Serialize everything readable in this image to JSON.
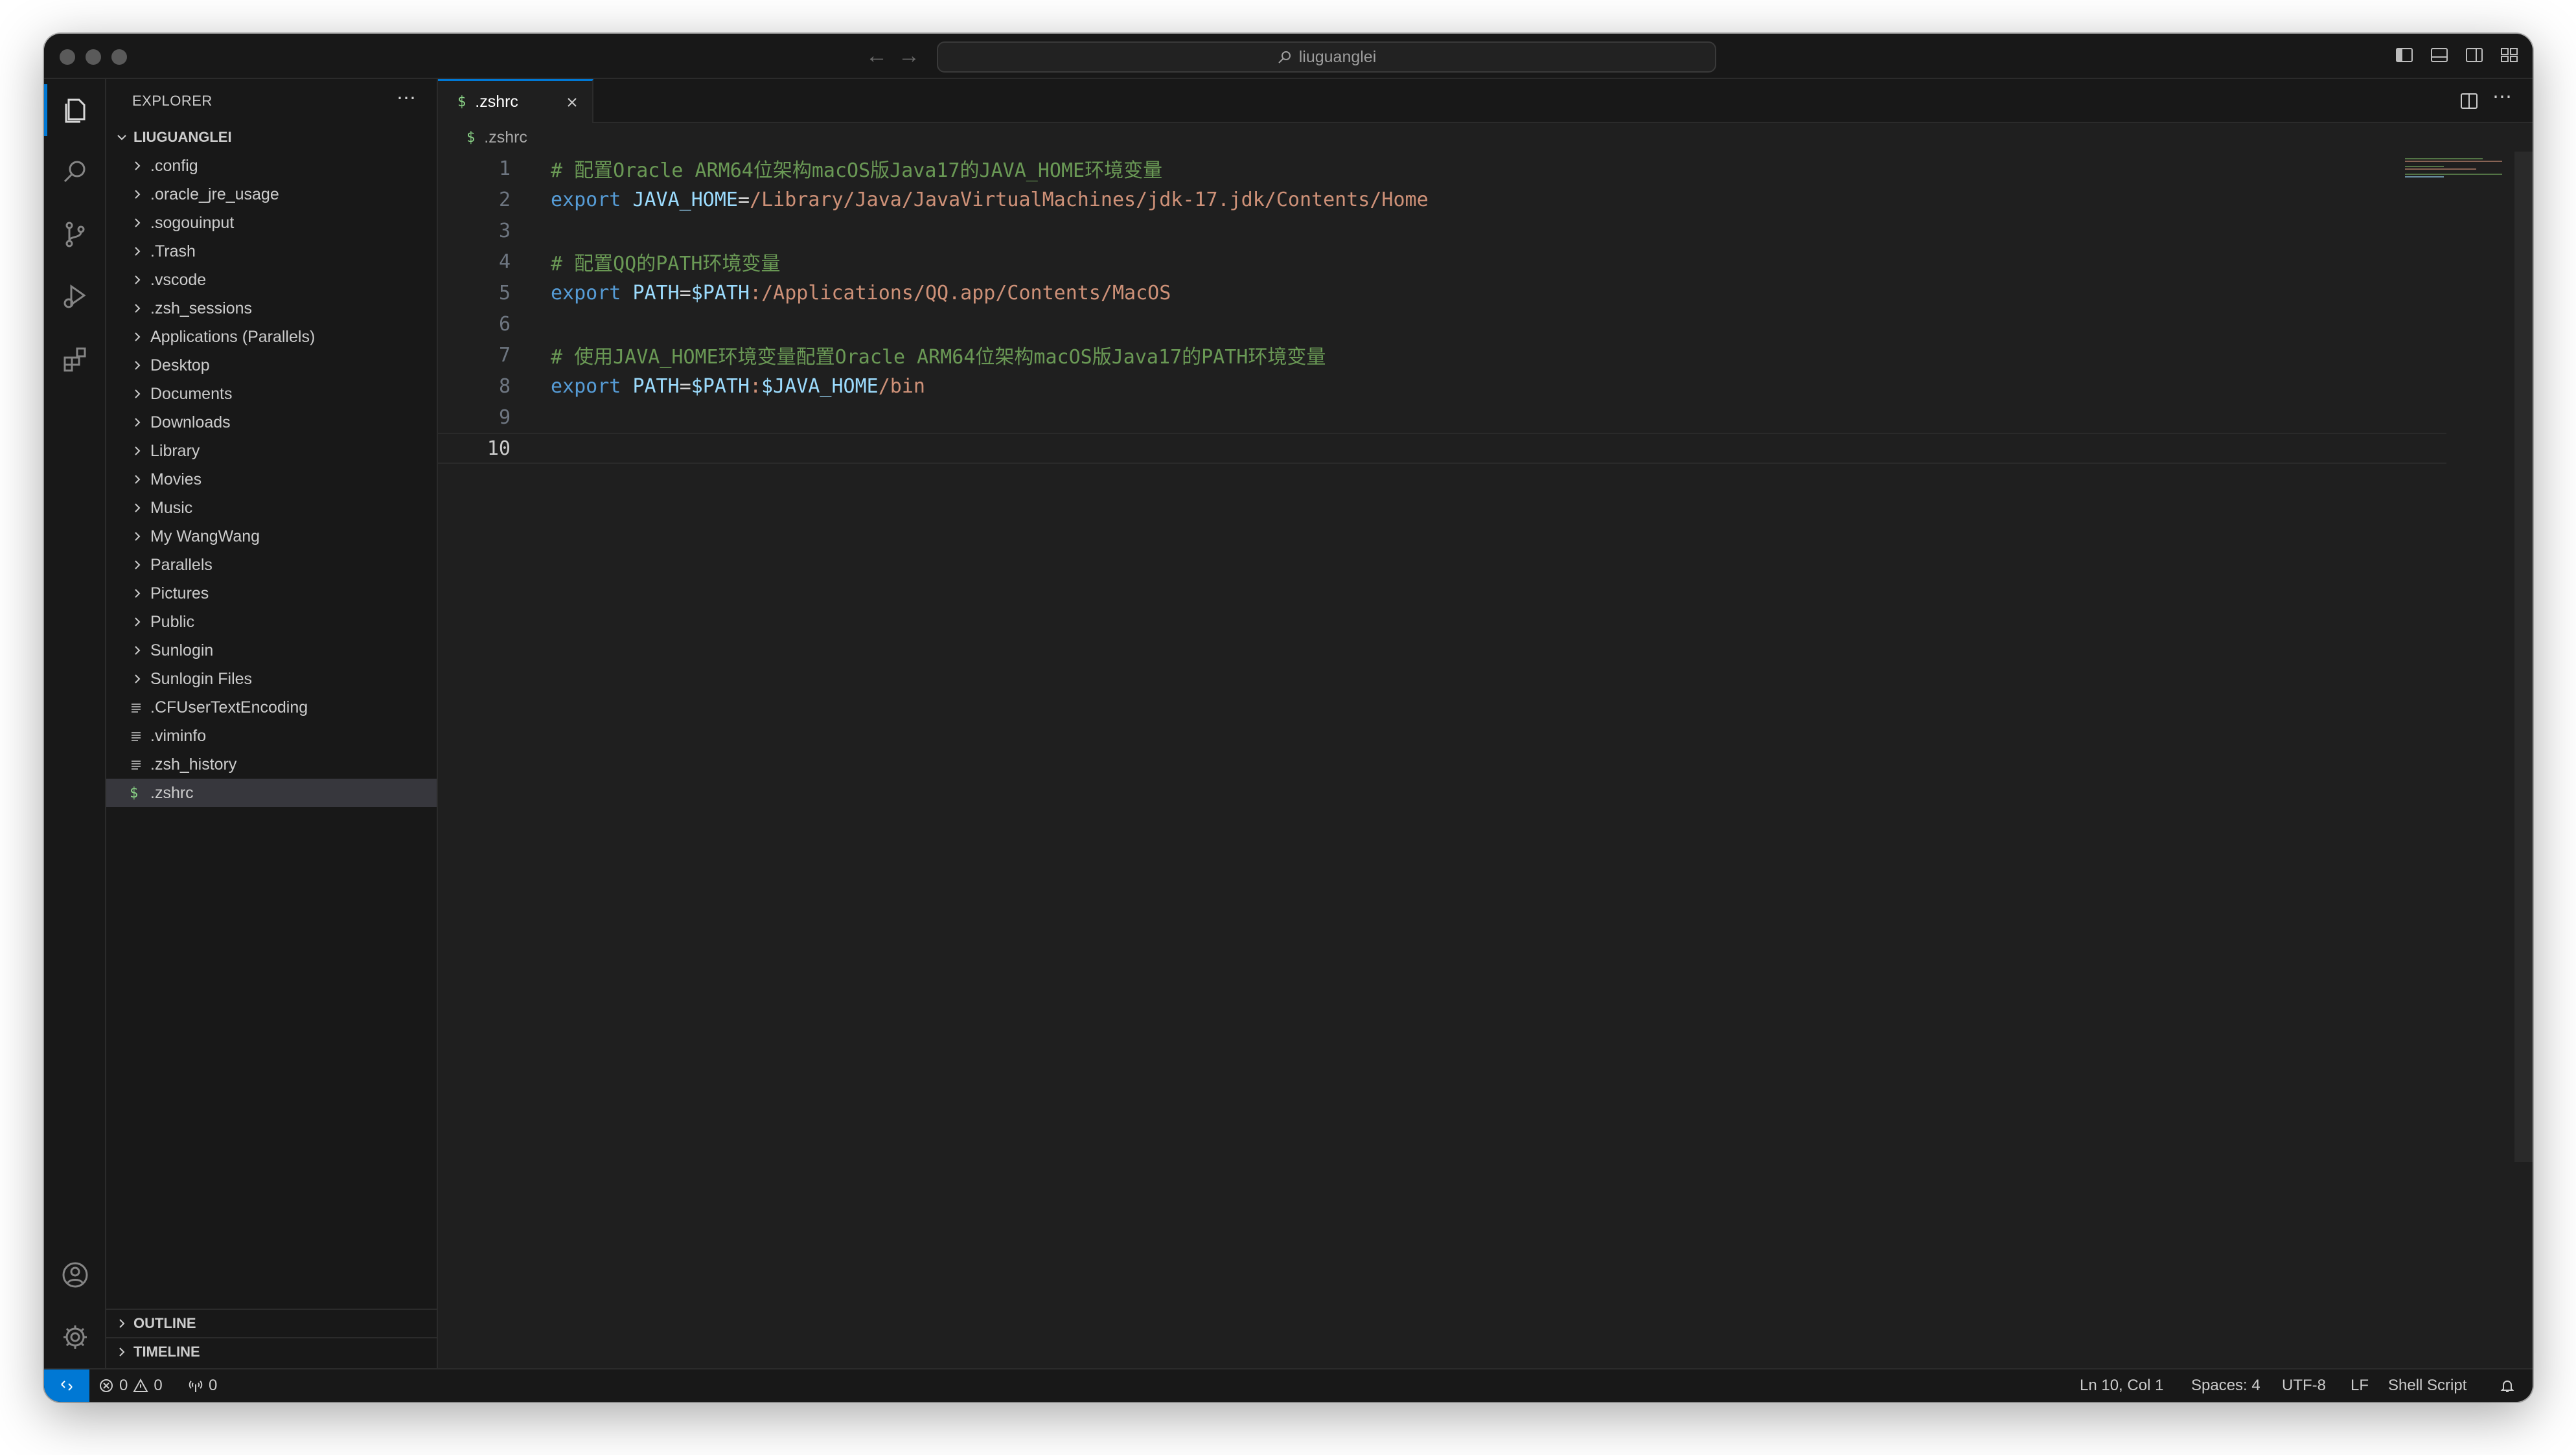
{
  "titlebar": {
    "command_center": "liuguanglei"
  },
  "sidebar": {
    "title": "EXPLORER",
    "folder": "LIUGUANGLEI",
    "items": [
      {
        "label": ".config",
        "kind": "folder"
      },
      {
        "label": ".oracle_jre_usage",
        "kind": "folder"
      },
      {
        "label": ".sogouinput",
        "kind": "folder"
      },
      {
        "label": ".Trash",
        "kind": "folder"
      },
      {
        "label": ".vscode",
        "kind": "folder"
      },
      {
        "label": ".zsh_sessions",
        "kind": "folder"
      },
      {
        "label": "Applications (Parallels)",
        "kind": "folder"
      },
      {
        "label": "Desktop",
        "kind": "folder"
      },
      {
        "label": "Documents",
        "kind": "folder"
      },
      {
        "label": "Downloads",
        "kind": "folder"
      },
      {
        "label": "Library",
        "kind": "folder"
      },
      {
        "label": "Movies",
        "kind": "folder"
      },
      {
        "label": "Music",
        "kind": "folder"
      },
      {
        "label": "My WangWang",
        "kind": "folder"
      },
      {
        "label": "Parallels",
        "kind": "folder"
      },
      {
        "label": "Pictures",
        "kind": "folder"
      },
      {
        "label": "Public",
        "kind": "folder"
      },
      {
        "label": "Sunlogin",
        "kind": "folder"
      },
      {
        "label": "Sunlogin Files",
        "kind": "folder"
      },
      {
        "label": ".CFUserTextEncoding",
        "kind": "file"
      },
      {
        "label": ".viminfo",
        "kind": "file"
      },
      {
        "label": ".zsh_history",
        "kind": "file"
      },
      {
        "label": ".zshrc",
        "kind": "shell",
        "selected": true
      }
    ],
    "outline": "OUTLINE",
    "timeline": "TIMELINE"
  },
  "editor": {
    "tab": ".zshrc",
    "breadcrumb": ".zshrc",
    "file_icon": "$",
    "lines": [
      {
        "num": "1",
        "comment": "# 配置Oracle ARM64位架构macOS版Java17的JAVA_HOME环境变量"
      },
      {
        "num": "2",
        "kw": "export",
        "var": "JAVA_HOME",
        "op": "=",
        "rest": "/Library/Java/JavaVirtualMachines/jdk-17.jdk/Contents/Home"
      },
      {
        "num": "3"
      },
      {
        "num": "4",
        "comment": "# 配置QQ的PATH环境变量"
      },
      {
        "num": "5",
        "kw": "export",
        "var": "PATH",
        "op": "=",
        "var2": "$PATH",
        "rest": ":/Applications/QQ.app/Contents/MacOS"
      },
      {
        "num": "6"
      },
      {
        "num": "7",
        "comment": "# 使用JAVA_HOME环境变量配置Oracle ARM64位架构macOS版Java17的PATH环境变量"
      },
      {
        "num": "8",
        "kw": "export",
        "var": "PATH",
        "op": "=",
        "var2": "$PATH",
        "op2": ":",
        "var3": "$JAVA_HOME",
        "rest": "/bin"
      },
      {
        "num": "9"
      },
      {
        "num": "10",
        "current": true
      }
    ]
  },
  "statusbar": {
    "errors": "0",
    "warnings": "0",
    "ports": "0",
    "position": "Ln 10, Col 1",
    "spaces": "Spaces: 4",
    "encoding": "UTF-8",
    "eol": "LF",
    "language": "Shell Script"
  },
  "colors": {
    "accent": "#0078d4",
    "comment": "#6a9955",
    "keyword": "#569cd6",
    "variable": "#9cdcfe",
    "string": "#ce9178",
    "shell_icon": "#89d185"
  }
}
